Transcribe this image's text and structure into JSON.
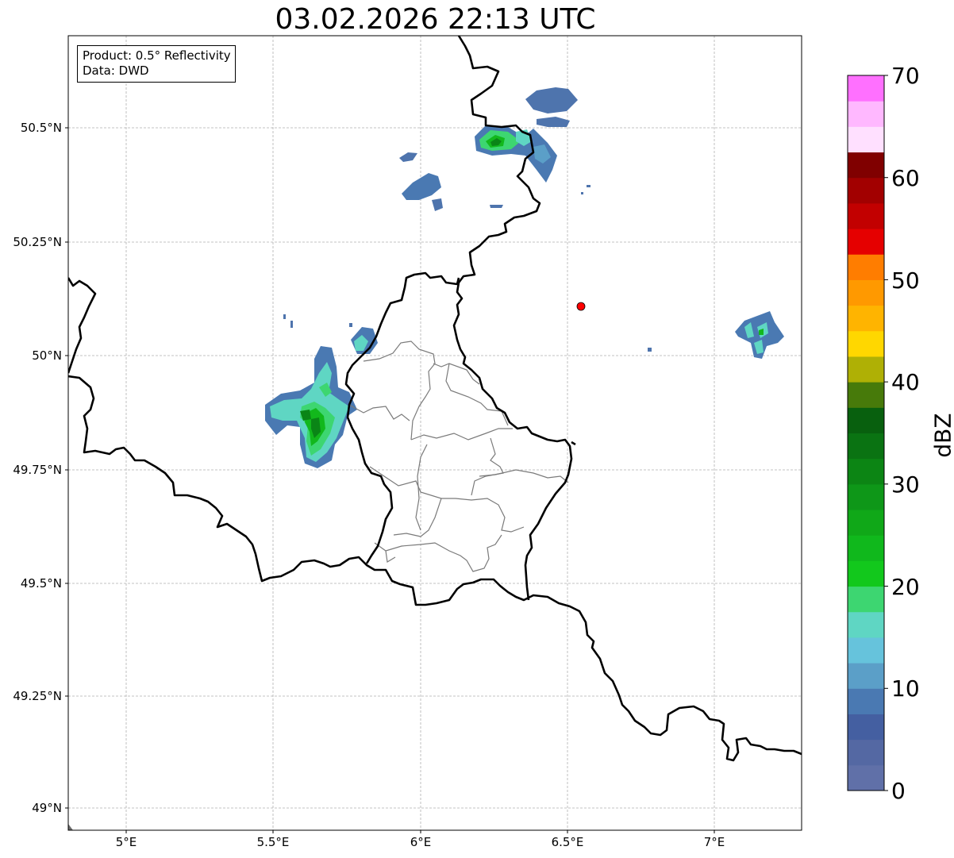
{
  "title": "03.02.2026 22:13 UTC",
  "info": {
    "product": "Product: 0.5° Reflectivity",
    "data": "Data: DWD"
  },
  "lat_labels": [
    "50.5°N",
    "50.25°N",
    "50°N",
    "49.75°N",
    "49.5°N",
    "49.25°N",
    "49°N"
  ],
  "lon_labels": [
    "5°E",
    "5.5°E",
    "6°E",
    "6.5°E",
    "7°E"
  ],
  "colorbar": {
    "label": "dBZ",
    "ticks": [
      "0",
      "10",
      "20",
      "30",
      "40",
      "50",
      "60",
      "70"
    ],
    "min": 0,
    "max": 70,
    "step": 2.5,
    "colors": [
      "#6070a8",
      "#5468a3",
      "#445fa1",
      "#4a79b2",
      "#5b9fc8",
      "#66c3dc",
      "#5fd6c3",
      "#3dd671",
      "#12c81c",
      "#10b81c",
      "#10a818",
      "#0e9718",
      "#0c8514",
      "#0a7312",
      "#08600e",
      "#477a0a",
      "#afb005",
      "#ffd700",
      "#ffb400",
      "#ff9900",
      "#ff7d00",
      "#e50000",
      "#c20000",
      "#a20000",
      "#800000",
      "#ffe0ff",
      "#ffb8ff",
      "#ff70ff",
      "#ee33ee"
    ]
  },
  "radar_site": {
    "lat": 50.11,
    "lon": 6.55,
    "color": "#ff0000"
  }
}
